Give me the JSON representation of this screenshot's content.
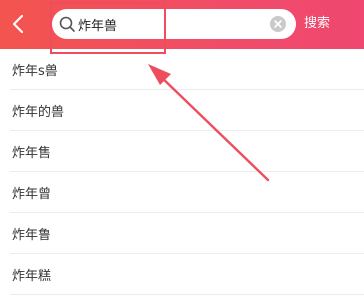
{
  "header": {
    "back_icon": "chevron-left-icon",
    "search": {
      "icon": "search-icon",
      "value": "炸年兽",
      "clear_icon": "clear-icon"
    },
    "search_button_label": "搜索",
    "accent_start": "#f3544e",
    "accent_end": "#ef476f"
  },
  "suggestions": [
    "炸年s兽",
    "炸年的兽",
    "炸年售",
    "炸年曾",
    "炸年鲁",
    "炸年糕"
  ],
  "annotation": {
    "color": "#ee4d5e"
  }
}
